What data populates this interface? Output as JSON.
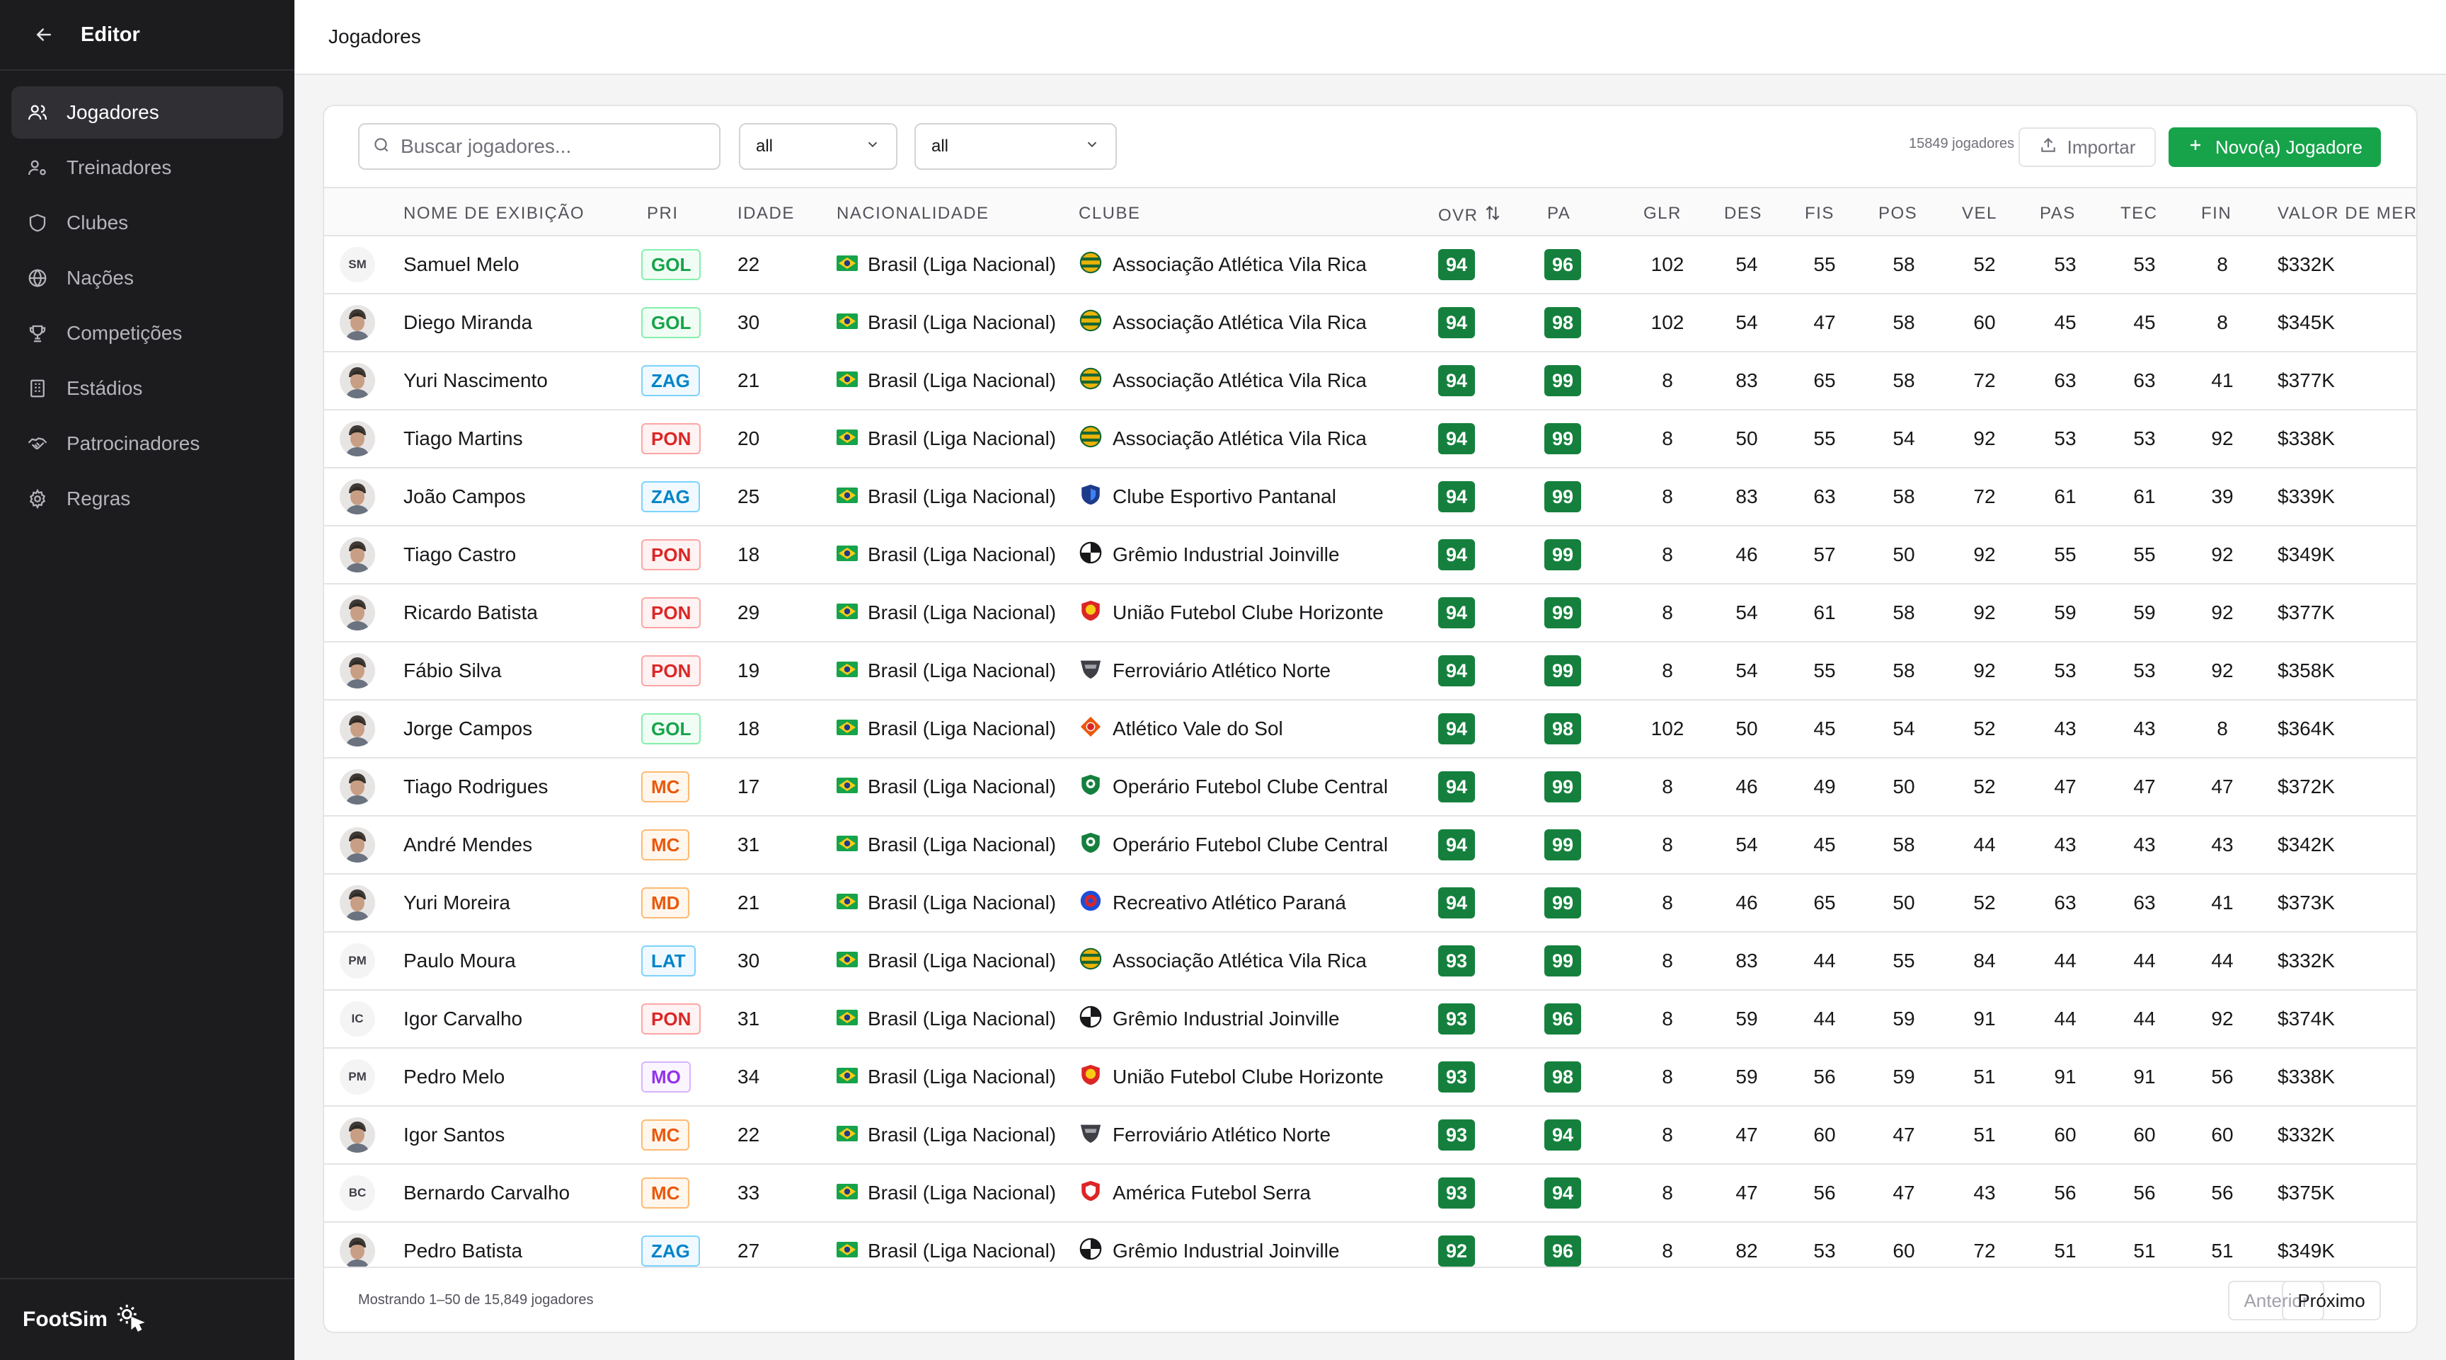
{
  "sidebar": {
    "title": "Editor",
    "items": [
      {
        "label": "Jogadores",
        "icon": "users-icon",
        "active": true
      },
      {
        "label": "Treinadores",
        "icon": "user-cog-icon",
        "active": false
      },
      {
        "label": "Clubes",
        "icon": "shield-icon",
        "active": false
      },
      {
        "label": "Nações",
        "icon": "globe-icon",
        "active": false
      },
      {
        "label": "Competições",
        "icon": "trophy-icon",
        "active": false
      },
      {
        "label": "Estádios",
        "icon": "building-icon",
        "active": false
      },
      {
        "label": "Patrocinadores",
        "icon": "handshake-icon",
        "active": false
      },
      {
        "label": "Regras",
        "icon": "gear-icon",
        "active": false
      }
    ],
    "brand": "FootSim"
  },
  "header": {
    "title": "Jogadores"
  },
  "toolbar": {
    "search_placeholder": "Buscar jogadores...",
    "filter1": "all",
    "filter2": "all",
    "count": "15849 jogadores",
    "import_label": "Importar",
    "new_label": "Novo(a) Jogadore"
  },
  "columns": {
    "name": "NOME DE EXIBIÇÃO",
    "pos": "PRI",
    "age": "IDADE",
    "nat": "NACIONALIDADE",
    "club": "CLUBE",
    "ovr": "OVR",
    "pa": "PA",
    "glr": "GLR",
    "des": "DES",
    "fis": "FIS",
    "posi": "POS",
    "vel": "VEL",
    "pas": "PAS",
    "tec": "TEC",
    "fin": "FIN",
    "value": "VALOR DE MERCADO"
  },
  "rows": [
    {
      "avatar": "SM",
      "name": "Samuel Melo",
      "pos": "GOL",
      "age": "22",
      "nat": "Brasil (Liga Nacional)",
      "club": "Associação Atlética Vila Rica",
      "crest": "stripes",
      "ovr": "94",
      "pa": "96",
      "glr": "102",
      "des": "54",
      "fis": "55",
      "posi": "58",
      "vel": "52",
      "pas": "53",
      "tec": "53",
      "fin": "8",
      "value": "$332K"
    },
    {
      "avatar": "",
      "name": "Diego Miranda",
      "pos": "GOL",
      "age": "30",
      "nat": "Brasil (Liga Nacional)",
      "club": "Associação Atlética Vila Rica",
      "crest": "stripes",
      "ovr": "94",
      "pa": "98",
      "glr": "102",
      "des": "54",
      "fis": "47",
      "posi": "58",
      "vel": "60",
      "pas": "45",
      "tec": "45",
      "fin": "8",
      "value": "$345K"
    },
    {
      "avatar": "",
      "name": "Yuri Nascimento",
      "pos": "ZAG",
      "age": "21",
      "nat": "Brasil (Liga Nacional)",
      "club": "Associação Atlética Vila Rica",
      "crest": "stripes",
      "ovr": "94",
      "pa": "99",
      "glr": "8",
      "des": "83",
      "fis": "65",
      "posi": "58",
      "vel": "72",
      "pas": "63",
      "tec": "63",
      "fin": "41",
      "value": "$377K"
    },
    {
      "avatar": "",
      "name": "Tiago Martins",
      "pos": "PON",
      "age": "20",
      "nat": "Brasil (Liga Nacional)",
      "club": "Associação Atlética Vila Rica",
      "crest": "stripes",
      "ovr": "94",
      "pa": "99",
      "glr": "8",
      "des": "50",
      "fis": "55",
      "posi": "54",
      "vel": "92",
      "pas": "53",
      "tec": "53",
      "fin": "92",
      "value": "$338K"
    },
    {
      "avatar": "",
      "name": "João Campos",
      "pos": "ZAG",
      "age": "25",
      "nat": "Brasil (Liga Nacional)",
      "club": "Clube Esportivo Pantanal",
      "crest": "blue",
      "ovr": "94",
      "pa": "99",
      "glr": "8",
      "des": "83",
      "fis": "63",
      "posi": "58",
      "vel": "72",
      "pas": "61",
      "tec": "61",
      "fin": "39",
      "value": "$339K"
    },
    {
      "avatar": "",
      "name": "Tiago Castro",
      "pos": "PON",
      "age": "18",
      "nat": "Brasil (Liga Nacional)",
      "club": "Grêmio Industrial Joinville",
      "crest": "ball",
      "ovr": "94",
      "pa": "99",
      "glr": "8",
      "des": "46",
      "fis": "57",
      "posi": "50",
      "vel": "92",
      "pas": "55",
      "tec": "55",
      "fin": "92",
      "value": "$349K"
    },
    {
      "avatar": "",
      "name": "Ricardo Batista",
      "pos": "PON",
      "age": "29",
      "nat": "Brasil (Liga Nacional)",
      "club": "União Futebol Clube Horizonte",
      "crest": "redyellow",
      "ovr": "94",
      "pa": "99",
      "glr": "8",
      "des": "54",
      "fis": "61",
      "posi": "58",
      "vel": "92",
      "pas": "59",
      "tec": "59",
      "fin": "92",
      "value": "$377K"
    },
    {
      "avatar": "",
      "name": "Fábio Silva",
      "pos": "PON",
      "age": "19",
      "nat": "Brasil (Liga Nacional)",
      "club": "Ferroviário Atlético Norte",
      "crest": "dark",
      "ovr": "94",
      "pa": "99",
      "glr": "8",
      "des": "54",
      "fis": "55",
      "posi": "58",
      "vel": "92",
      "pas": "53",
      "tec": "53",
      "fin": "92",
      "value": "$358K"
    },
    {
      "avatar": "",
      "name": "Jorge Campos",
      "pos": "GOL",
      "age": "18",
      "nat": "Brasil (Liga Nacional)",
      "club": "Atlético Vale do Sol",
      "crest": "diamond",
      "ovr": "94",
      "pa": "98",
      "glr": "102",
      "des": "50",
      "fis": "45",
      "posi": "54",
      "vel": "52",
      "pas": "43",
      "tec": "43",
      "fin": "8",
      "value": "$364K"
    },
    {
      "avatar": "",
      "name": "Tiago Rodrigues",
      "pos": "MC",
      "age": "17",
      "nat": "Brasil (Liga Nacional)",
      "club": "Operário Futebol Clube Central",
      "crest": "green",
      "ovr": "94",
      "pa": "99",
      "glr": "8",
      "des": "46",
      "fis": "49",
      "posi": "50",
      "vel": "52",
      "pas": "47",
      "tec": "47",
      "fin": "47",
      "value": "$372K"
    },
    {
      "avatar": "",
      "name": "André Mendes",
      "pos": "MC",
      "age": "31",
      "nat": "Brasil (Liga Nacional)",
      "club": "Operário Futebol Clube Central",
      "crest": "green",
      "ovr": "94",
      "pa": "99",
      "glr": "8",
      "des": "54",
      "fis": "45",
      "posi": "58",
      "vel": "44",
      "pas": "43",
      "tec": "43",
      "fin": "43",
      "value": "$342K"
    },
    {
      "avatar": "",
      "name": "Yuri Moreira",
      "pos": "MD",
      "age": "21",
      "nat": "Brasil (Liga Nacional)",
      "club": "Recreativo Atlético Paraná",
      "crest": "bluered",
      "ovr": "94",
      "pa": "99",
      "glr": "8",
      "des": "46",
      "fis": "65",
      "posi": "50",
      "vel": "52",
      "pas": "63",
      "tec": "63",
      "fin": "41",
      "value": "$373K"
    },
    {
      "avatar": "PM",
      "name": "Paulo Moura",
      "pos": "LAT",
      "age": "30",
      "nat": "Brasil (Liga Nacional)",
      "club": "Associação Atlética Vila Rica",
      "crest": "stripes",
      "ovr": "93",
      "pa": "99",
      "glr": "8",
      "des": "83",
      "fis": "44",
      "posi": "55",
      "vel": "84",
      "pas": "44",
      "tec": "44",
      "fin": "44",
      "value": "$332K"
    },
    {
      "avatar": "IC",
      "name": "Igor Carvalho",
      "pos": "PON",
      "age": "31",
      "nat": "Brasil (Liga Nacional)",
      "club": "Grêmio Industrial Joinville",
      "crest": "ball",
      "ovr": "93",
      "pa": "96",
      "glr": "8",
      "des": "59",
      "fis": "44",
      "posi": "59",
      "vel": "91",
      "pas": "44",
      "tec": "44",
      "fin": "92",
      "value": "$374K"
    },
    {
      "avatar": "PM",
      "name": "Pedro Melo",
      "pos": "MO",
      "age": "34",
      "nat": "Brasil (Liga Nacional)",
      "club": "União Futebol Clube Horizonte",
      "crest": "redyellow",
      "ovr": "93",
      "pa": "98",
      "glr": "8",
      "des": "59",
      "fis": "56",
      "posi": "59",
      "vel": "51",
      "pas": "91",
      "tec": "91",
      "fin": "56",
      "value": "$338K"
    },
    {
      "avatar": "",
      "name": "Igor Santos",
      "pos": "MC",
      "age": "22",
      "nat": "Brasil (Liga Nacional)",
      "club": "Ferroviário Atlético Norte",
      "crest": "dark",
      "ovr": "93",
      "pa": "94",
      "glr": "8",
      "des": "47",
      "fis": "60",
      "posi": "47",
      "vel": "51",
      "pas": "60",
      "tec": "60",
      "fin": "60",
      "value": "$332K"
    },
    {
      "avatar": "BC",
      "name": "Bernardo Carvalho",
      "pos": "MC",
      "age": "33",
      "nat": "Brasil (Liga Nacional)",
      "club": "América Futebol Serra",
      "crest": "red",
      "ovr": "93",
      "pa": "94",
      "glr": "8",
      "des": "47",
      "fis": "56",
      "posi": "47",
      "vel": "43",
      "pas": "56",
      "tec": "56",
      "fin": "56",
      "value": "$375K"
    },
    {
      "avatar": "",
      "name": "Pedro Batista",
      "pos": "ZAG",
      "age": "27",
      "nat": "Brasil (Liga Nacional)",
      "club": "Grêmio Industrial Joinville",
      "crest": "ball",
      "ovr": "92",
      "pa": "96",
      "glr": "8",
      "des": "82",
      "fis": "53",
      "posi": "60",
      "vel": "72",
      "pas": "51",
      "tec": "51",
      "fin": "51",
      "value": "$349K"
    }
  ],
  "pos_colors": {
    "GOL": {
      "fg": "#16a34a",
      "bg": "#f0fdf4",
      "border": "#86efac"
    },
    "ZAG": {
      "fg": "#0284c7",
      "bg": "#f0f9ff",
      "border": "#7dd3fc"
    },
    "LAT": {
      "fg": "#0284c7",
      "bg": "#f0f9ff",
      "border": "#7dd3fc"
    },
    "PON": {
      "fg": "#dc2626",
      "bg": "#fef2f2",
      "border": "#fca5a5"
    },
    "MC": {
      "fg": "#ea580c",
      "bg": "#fff7ed",
      "border": "#fdba74"
    },
    "MD": {
      "fg": "#ea580c",
      "bg": "#fff7ed",
      "border": "#fdba74"
    },
    "MO": {
      "fg": "#9333ea",
      "bg": "#faf5ff",
      "border": "#d8b4fe"
    }
  },
  "footer": {
    "showing": "Mostrando 1–50 de 15,849 jogadores",
    "prev": "Anterior",
    "next": "Próximo"
  }
}
